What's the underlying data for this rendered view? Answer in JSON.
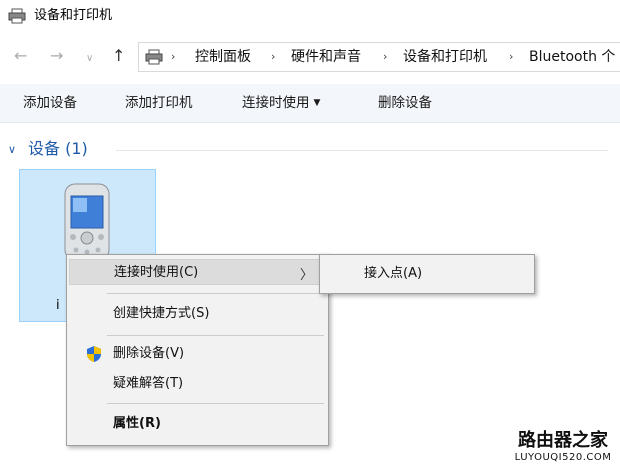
{
  "window": {
    "title": "设备和打印机"
  },
  "address": {
    "segments": [
      "控制面板",
      "硬件和声音",
      "设备和打印机",
      "Bluetooth 个"
    ]
  },
  "commands": [
    "添加设备",
    "添加打印机",
    "连接时使用",
    "删除设备"
  ],
  "group": {
    "label": "设备 (1)"
  },
  "device": {
    "label": "i"
  },
  "context_menu": {
    "items": [
      "连接时使用(C)",
      "创建快捷方式(S)",
      "删除设备(V)",
      "疑难解答(T)",
      "属性(R)"
    ]
  },
  "submenu": {
    "items": [
      "接入点(A)"
    ]
  },
  "watermark": {
    "text": "路由器之家",
    "url": "LUYOUQI520.COM"
  },
  "colors": {
    "accent": "#1e5aa8",
    "selection": "#cde8fb",
    "menu_bg": "#f2f2f2"
  }
}
